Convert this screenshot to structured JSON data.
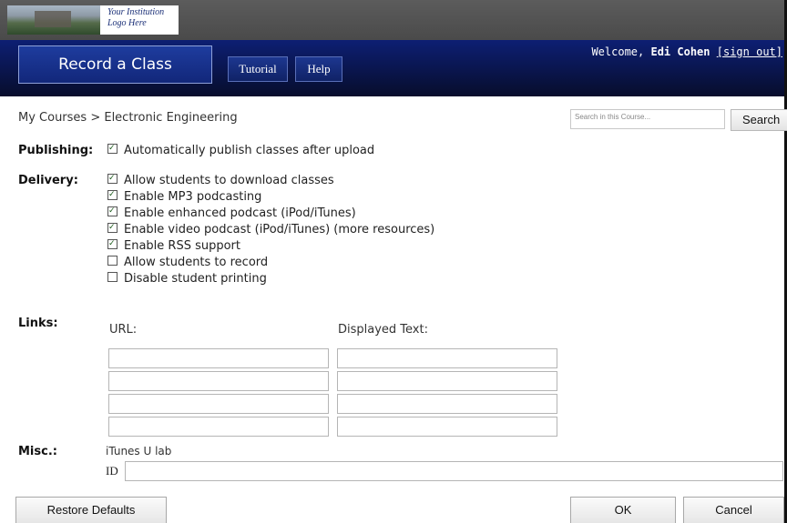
{
  "header": {
    "logo_line1": "Your Institution",
    "logo_line2": "Logo Here",
    "page_title": "Record a Class",
    "tabs": [
      {
        "label": "Tutorial"
      },
      {
        "label": "Help"
      }
    ],
    "welcome_prefix": "Welcome, ",
    "user_name": "Edi Cohen",
    "sign_out": "[sign out]"
  },
  "breadcrumb": "My Courses > Electronic Engineering",
  "search": {
    "placeholder": "Search in this Course...",
    "button": "Search"
  },
  "publishing": {
    "label": "Publishing:",
    "options": [
      {
        "label": "Automatically publish classes after upload",
        "checked": true
      }
    ]
  },
  "delivery": {
    "label": "Delivery:",
    "options": [
      {
        "label": "Allow students to download classes",
        "checked": true
      },
      {
        "label": "Enable MP3 podcasting",
        "checked": true
      },
      {
        "label": "Enable enhanced podcast (iPod/iTunes)",
        "checked": true
      },
      {
        "label": "Enable video podcast (iPod/iTunes) (more resources)",
        "checked": true
      },
      {
        "label": "Enable RSS support",
        "checked": true
      },
      {
        "label": "Allow students to record",
        "checked": false
      },
      {
        "label": "Disable student printing",
        "checked": false
      }
    ]
  },
  "links": {
    "label": "Links:",
    "url_header": "URL:",
    "text_header": "Displayed Text:",
    "rows": [
      {
        "url": "",
        "text": ""
      },
      {
        "url": "",
        "text": ""
      },
      {
        "url": "",
        "text": ""
      },
      {
        "url": "",
        "text": ""
      }
    ]
  },
  "misc": {
    "label": "Misc.:",
    "itunes_label": "iTunes U lab",
    "id_label": "ID",
    "id_value": ""
  },
  "buttons": {
    "restore": "Restore Defaults",
    "ok": "OK",
    "cancel": "Cancel"
  },
  "colors": {
    "nav_bg": "#0a1650",
    "top_bg": "#4f4f4f",
    "title_bg": "#12277a"
  }
}
